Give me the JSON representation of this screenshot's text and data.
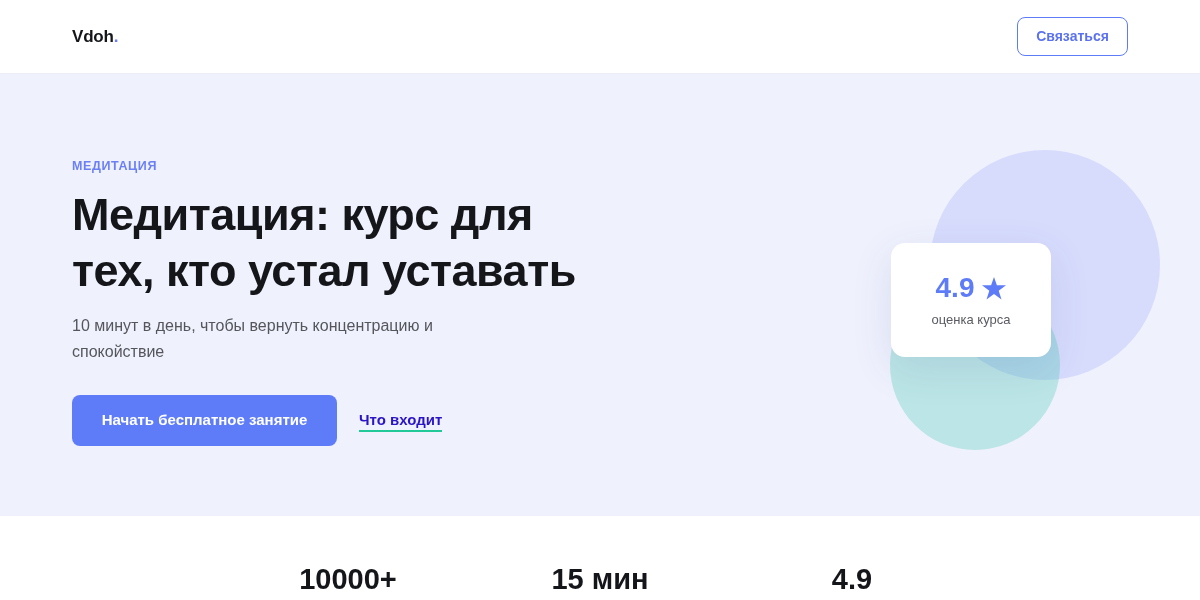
{
  "header": {
    "logo": {
      "name": "Vdoh",
      "mark": "."
    },
    "contact_button": "Связаться"
  },
  "hero": {
    "eyebrow": "МЕДИТАЦИЯ",
    "title": "Медитация: курс для тех, кто устал уставать",
    "subtitle": "10 минут в день, чтобы вернуть концентрацию и спокойствие",
    "primary_button": "Начать бесплатное занятие",
    "secondary_link": "Что входит",
    "rating_card": {
      "value": "4.9",
      "label": "оценка курса"
    }
  },
  "stats": [
    {
      "value": "10000+"
    },
    {
      "value": "15 мин"
    },
    {
      "value": "4.9"
    }
  ]
}
